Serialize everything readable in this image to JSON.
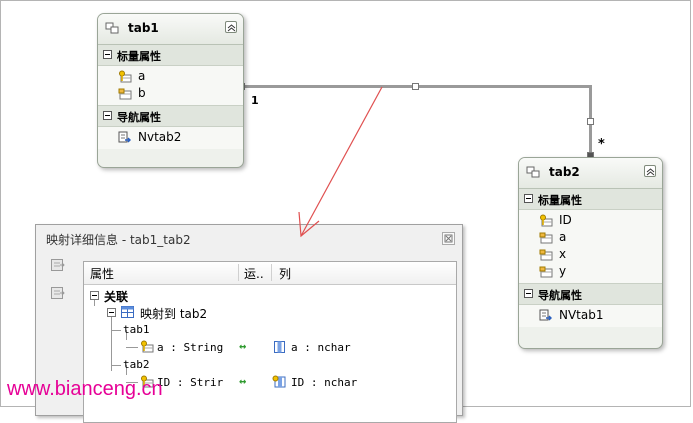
{
  "tab1": {
    "title": "tab1",
    "scalar_section": "标量属性",
    "scalar_props": [
      "a",
      "b"
    ],
    "nav_section": "导航属性",
    "nav_props": [
      "Nvtab2"
    ]
  },
  "tab2": {
    "title": "tab2",
    "scalar_section": "标量属性",
    "scalar_props": [
      "ID",
      "a",
      "x",
      "y"
    ],
    "nav_section": "导航属性",
    "nav_props": [
      "NVtab1"
    ]
  },
  "association": {
    "left_multiplicity": "1",
    "right_multiplicity": "*"
  },
  "mapping_window": {
    "title": "映射详细信息 - tab1_tab2",
    "columns": {
      "property": "属性",
      "operator": "运..",
      "column": "列"
    },
    "root": "关联",
    "maps_to": "映射到 tab2",
    "groups": [
      {
        "name": "tab1",
        "property": "a : String",
        "column": "a : nchar"
      },
      {
        "name": "tab2",
        "property": "ID : Strir",
        "column": "ID : nchar"
      }
    ]
  },
  "watermark": "www.bianceng.cn",
  "colors": {
    "annotation_arrow": "#e05050",
    "watermark": "#e60096",
    "map_arrow": "#2e9a2e"
  }
}
